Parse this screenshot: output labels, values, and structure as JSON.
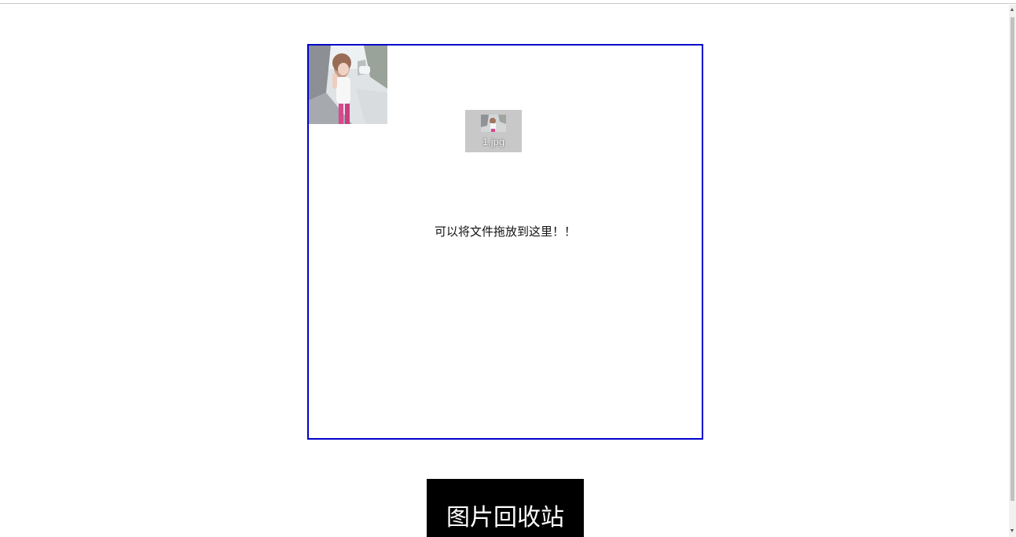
{
  "drop_zone": {
    "hint": "可以将文件拖放到这里！！",
    "border_color": "#0000cc",
    "thumbnail_icon": "photo-thumbnail-icon"
  },
  "drag_ghost": {
    "file_name": "1.jpg",
    "icon": "image-file-icon"
  },
  "recycle_bin": {
    "label": "图片回收站",
    "background": "#000000",
    "text_color": "#ffffff"
  }
}
